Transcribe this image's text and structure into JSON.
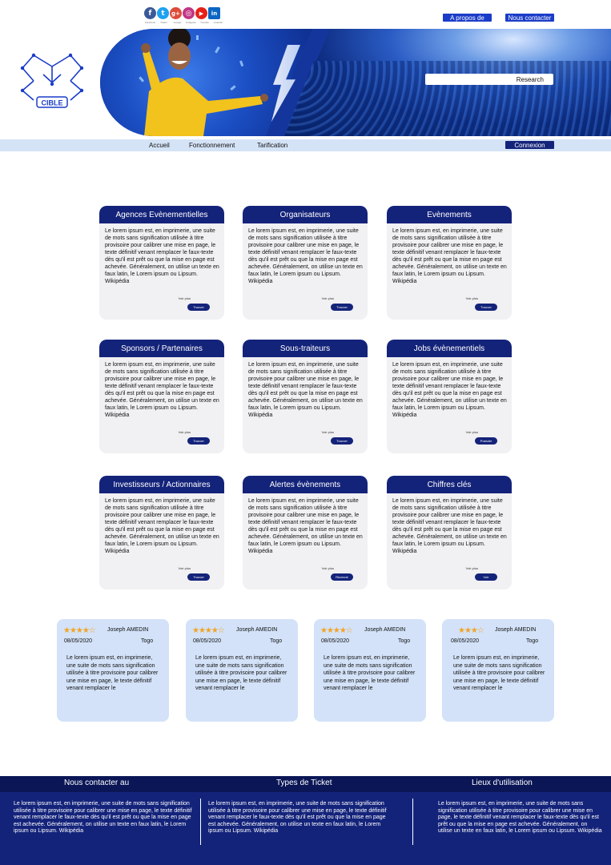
{
  "topbar": {
    "social": [
      {
        "name": "facebook-icon",
        "glyph": "f",
        "color": "#3b5998"
      },
      {
        "name": "twitter-icon",
        "glyph": "t",
        "color": "#1da1f2"
      },
      {
        "name": "google-plus-icon",
        "glyph": "g+",
        "color": "#dd4b39"
      },
      {
        "name": "instagram-icon",
        "glyph": "◎",
        "color": "#c13584"
      },
      {
        "name": "youtube-icon",
        "glyph": "▶",
        "color": "#e62117"
      },
      {
        "name": "linkedin-icon",
        "glyph": "in",
        "color": "#0a66c2"
      }
    ],
    "social_labels": [
      "Facebook",
      "Twitter",
      "Google",
      "Instagram",
      "Youtube",
      "Linkedin"
    ],
    "about_label": "A propos de",
    "contact_label": "Nous contacter"
  },
  "logo": {
    "text": "CIBLE"
  },
  "search": {
    "label": "Research"
  },
  "nav": {
    "items": [
      "Accueil",
      "Fonctionnement",
      "Tarification"
    ],
    "login_label": "Connexion"
  },
  "cards": [
    {
      "title": "Agences Evènementielles",
      "text": "Le lorem ipsum est, en imprimerie, une suite de mots sans signification utilisée à titre provisoire pour calibrer une mise en page, le texte définitif venant remplacer le faux-texte dès qu'il est prêt ou que la mise en page est achevée. Généralement, on utilise un texte en faux latin, le Lorem ipsum ou Lipsum. Wikipédia",
      "more": "Voir plus",
      "btn": "Trouver"
    },
    {
      "title": "Organisateurs",
      "text": "Le lorem ipsum est, en imprimerie, une suite de mots sans signification utilisée à titre provisoire pour calibrer une mise en page, le texte définitif venant remplacer le faux-texte dès qu'il est prêt ou que la mise en page est achevée. Généralement, on utilise un texte en faux latin, le Lorem ipsum ou Lipsum. Wikipédia",
      "more": "Voir plus",
      "btn": "Trouver"
    },
    {
      "title": "Evènements",
      "text": "Le lorem ipsum est, en imprimerie, une suite de mots sans signification utilisée à titre provisoire pour calibrer une mise en page, le texte définitif venant remplacer le faux-texte dès qu'il est prêt ou que la mise en page est achevée. Généralement, on utilise un texte en faux latin, le Lorem ipsum ou Lipsum. Wikipédia",
      "more": "Voir plus",
      "btn": "Trouver"
    },
    {
      "title": "Sponsors / Partenaires",
      "text": "Le lorem ipsum est, en imprimerie, une suite de mots sans signification utilisée à titre provisoire pour calibrer une mise en page, le texte définitif venant remplacer le faux-texte dès qu'il est prêt ou que la mise en page est achevée. Généralement, on utilise un texte en faux latin, le Lorem ipsum ou Lipsum. Wikipédia",
      "more": "Voir plus",
      "btn": "Trouver"
    },
    {
      "title": "Sous-traiteurs",
      "text": "Le lorem ipsum est, en imprimerie, une suite de mots sans signification utilisée à titre provisoire pour calibrer une mise en page, le texte définitif venant remplacer le faux-texte dès qu'il est prêt ou que la mise en page est achevée. Généralement, on utilise un texte en faux latin, le Lorem ipsum ou Lipsum. Wikipédia",
      "more": "Voir plus",
      "btn": "Trouver"
    },
    {
      "title": "Jobs évènementiels",
      "text": "Le lorem ipsum est, en imprimerie, une suite de mots sans signification utilisée à titre provisoire pour calibrer une mise en page, le texte définitif venant remplacer le faux-texte dès qu'il est prêt ou que la mise en page est achevée. Généralement, on utilise un texte en faux latin, le Lorem ipsum ou Lipsum. Wikipédia",
      "more": "Voir plus",
      "btn": "Postuler"
    },
    {
      "title": "Investisseurs / Actionnaires",
      "text": "Le lorem ipsum est, en imprimerie, une suite de mots sans signification utilisée à titre provisoire pour calibrer une mise en page, le texte définitif venant remplacer le faux-texte dès qu'il est prêt ou que la mise en page est achevée. Généralement, on utilise un texte en faux latin, le Lorem ipsum ou Lipsum. Wikipédia",
      "more": "Voir plus",
      "btn": "Trouver"
    },
    {
      "title": "Alertes évènements",
      "text": "Le lorem ipsum est, en imprimerie, une suite de mots sans signification utilisée à titre provisoire pour calibrer une mise en page, le texte définitif venant remplacer le faux-texte dès qu'il est prêt ou que la mise en page est achevée. Généralement, on utilise un texte en faux latin, le Lorem ipsum ou Lipsum. Wikipédia",
      "more": "Voir plus",
      "btn": "Recevoir"
    },
    {
      "title": "Chiffres clés",
      "text": "Le lorem ipsum est, en imprimerie, une suite de mots sans signification utilisée à titre provisoire pour calibrer une mise en page, le texte définitif venant remplacer le faux-texte dès qu'il est prêt ou que la mise en page est achevée. Généralement, on utilise un texte en faux latin, le Lorem ipsum ou Lipsum. Wikipédia",
      "more": "Voir plus",
      "btn": "Voir"
    }
  ],
  "reviews": [
    {
      "stars": "★★★★☆",
      "rating": 4,
      "name": "Joseph AMEDIN",
      "date": "08/05/2020",
      "country": "Togo",
      "text": "Le lorem ipsum est, en imprimerie, une suite de mots sans signification utilisée à titre provisoire pour calibrer une mise en page, le texte définitif venant remplacer le"
    },
    {
      "stars": "★★★★☆",
      "rating": 4,
      "name": "Joseph AMEDIN",
      "date": "08/05/2020",
      "country": "Togo",
      "text": "Le lorem ipsum est, en imprimerie, une suite de mots sans signification utilisée à titre provisoire pour calibrer une mise en page, le texte définitif venant remplacer le"
    },
    {
      "stars": "★★★★☆",
      "rating": 4,
      "name": "Joseph AMEDIN",
      "date": "08/05/2020",
      "country": "Togo",
      "text": "Le lorem ipsum est, en imprimerie, une suite de mots sans signification utilisée à titre provisoire pour calibrer une mise en page, le texte définitif venant remplacer le"
    },
    {
      "stars": "★★★☆",
      "rating": 3,
      "name": "Joseph AMEDIN",
      "date": "08/05/2020",
      "country": "Togo",
      "text": "Le lorem ipsum est, en imprimerie, une suite de mots sans signification utilisée à titre provisoire pour calibrer une mise en page, le texte définitif venant remplacer le"
    }
  ],
  "footer": {
    "columns": [
      {
        "title": "Nous contacter au",
        "text": "Le lorem ipsum est, en imprimerie, une suite de mots sans signification utilisée à titre provisoire pour calibrer une mise en page, le texte définitif venant remplacer le faux-texte dès qu'il est prêt ou que la mise en page est achevée. Généralement, on utilise un texte en faux latin, le Lorem ipsum ou Lipsum. Wikipédia"
      },
      {
        "title": "Types de Ticket",
        "text": "Le lorem ipsum est, en imprimerie, une suite de mots sans signification utilisée à titre provisoire pour calibrer une mise en page, le texte définitif venant remplacer le faux-texte dès qu'il est prêt ou que la mise en page est achevée. Généralement, on utilise un texte en faux latin, le Lorem ipsum ou Lipsum. Wikipédia"
      },
      {
        "title": "Lieux d'utilisation",
        "text": "Le lorem ipsum est, en imprimerie, une suite de mots sans signification utilisée à titre provisoire pour calibrer une mise en page, le texte définitif venant remplacer le faux-texte dès qu'il est prêt ou que la mise en page est achevée. Généralement, on utilise un texte en faux latin, le Lorem ipsum ou Lipsum. Wikipédia"
      }
    ]
  },
  "colors": {
    "primary": "#14237a",
    "accent": "#1a3cc8",
    "nav_bg": "#d5e3f7",
    "card_bg": "#f1f0f2",
    "review_bg": "#d3e2f8",
    "star": "#f3a321"
  }
}
